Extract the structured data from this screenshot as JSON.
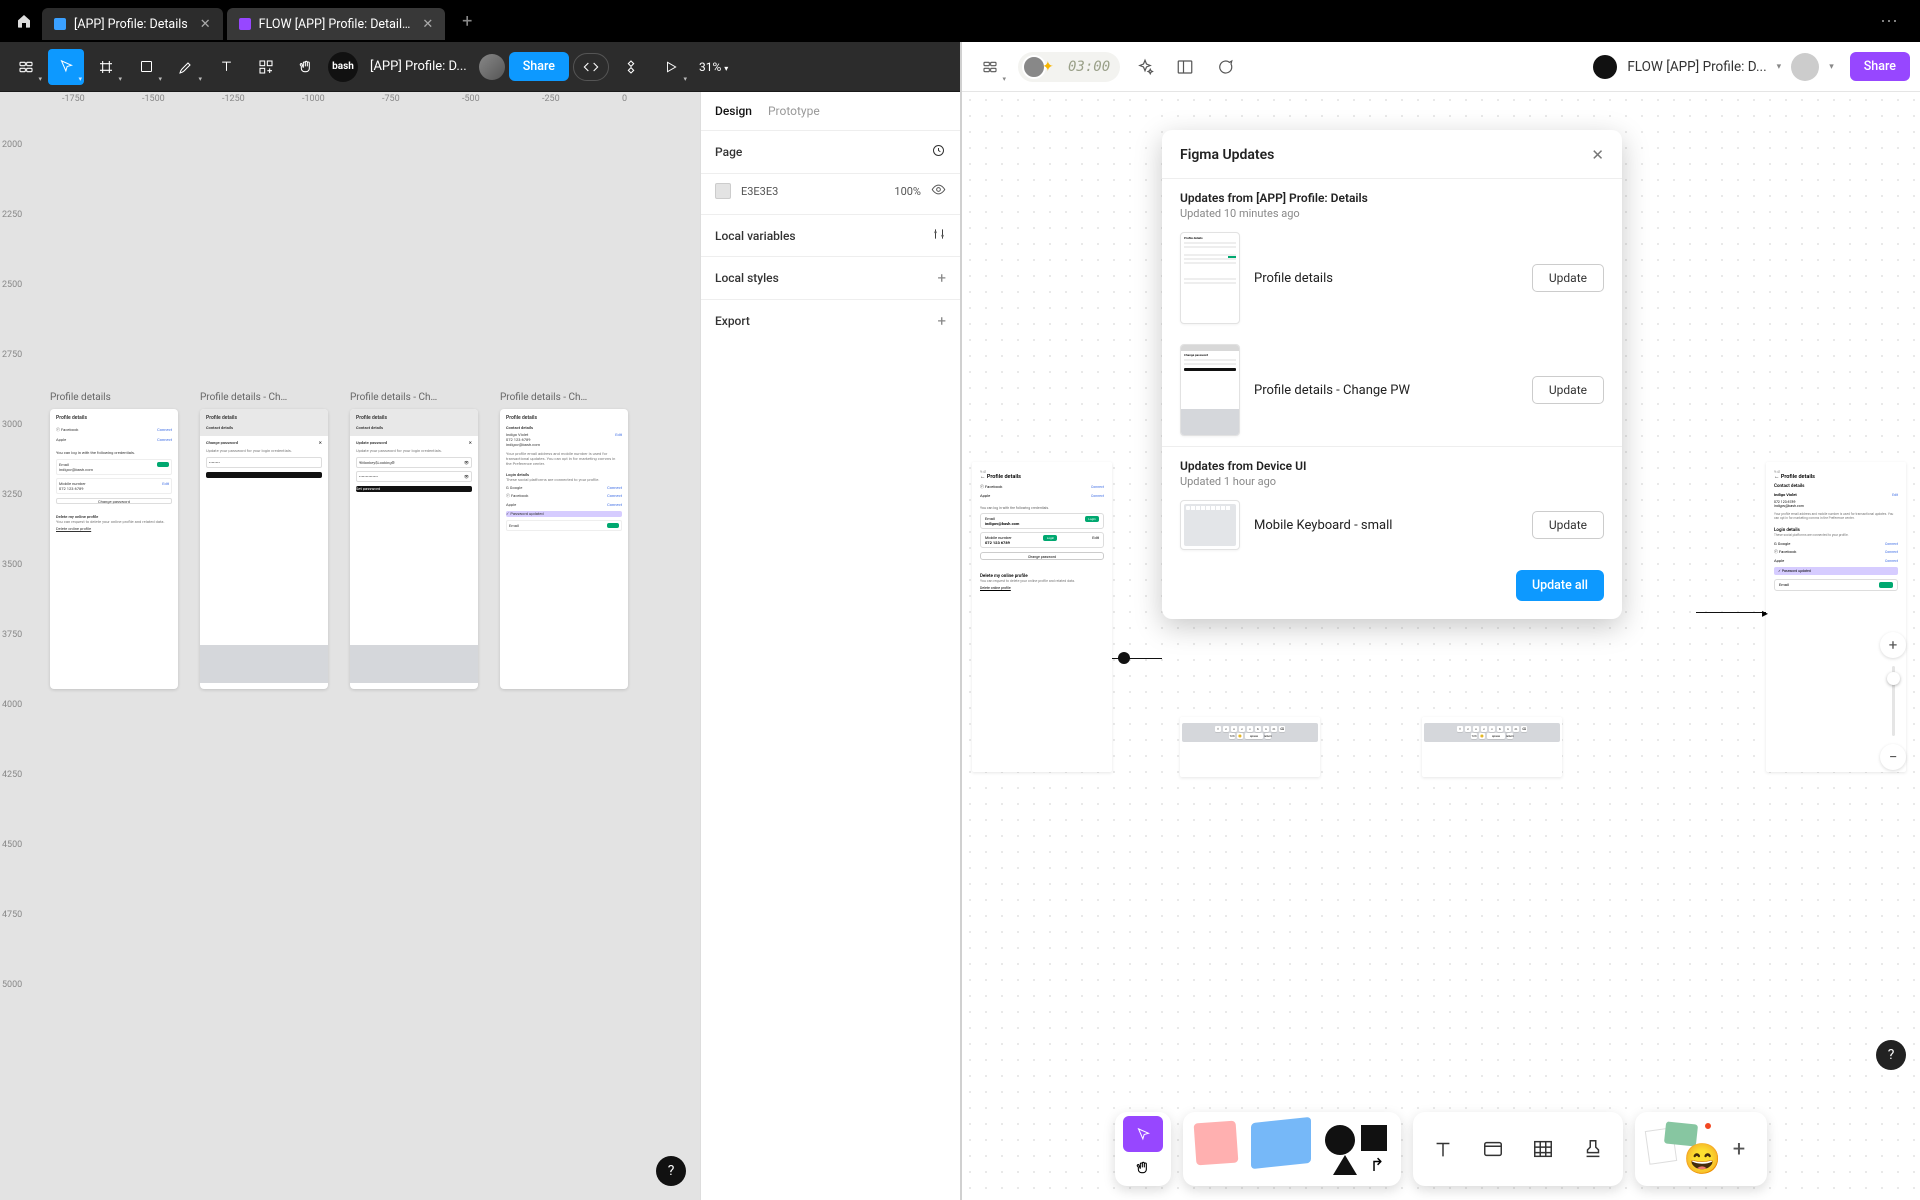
{
  "tabs": [
    {
      "label": "[APP] Profile: Details",
      "color": "#3aa0ff"
    },
    {
      "label": "FLOW [APP] Profile: Detail…",
      "color": "#9747ff"
    }
  ],
  "left": {
    "doc_title": "[APP] Profile: D...",
    "share": "Share",
    "zoom": "31%",
    "ruler_h": [
      "-1750",
      "-1500",
      "-1250",
      "-1000",
      "-750",
      "-500",
      "-250",
      "0"
    ],
    "ruler_v": [
      "2000",
      "2250",
      "2500",
      "2750",
      "3000",
      "3250",
      "3500",
      "3750",
      "4000",
      "4250",
      "4500",
      "4750",
      "5000"
    ],
    "frames": [
      "Profile details",
      "Profile details - Ch…",
      "Profile details - Ch…",
      "Profile details - Ch…"
    ],
    "panel": {
      "tabs": {
        "design": "Design",
        "prototype": "Prototype"
      },
      "page_label": "Page",
      "color_hex": "E3E3E3",
      "color_opacity": "100%",
      "local_variables": "Local variables",
      "local_styles": "Local styles",
      "export": "Export"
    }
  },
  "right": {
    "doc_title": "FLOW [APP] Profile: D...",
    "timer": "03:00",
    "share": "Share",
    "popup": {
      "title": "Figma Updates",
      "group1_title": "Updates from [APP] Profile: Details",
      "group1_sub": "Updated 10 minutes ago",
      "item1": "Profile details",
      "item2": "Profile details - Change PW",
      "group2_title": "Updates from Device  UI",
      "group2_sub": "Updated 1 hour ago",
      "item3": "Mobile Keyboard - small",
      "update_btn": "Update",
      "update_all": "Update all"
    },
    "artboards": {
      "hdr": "Profile details",
      "contact": "Contact details",
      "name": "Indigo Violet",
      "phone": "072 123 6789",
      "email": "indigov@bash.com",
      "edit": "Edit",
      "connect": "Connect",
      "fb": "Facebook",
      "apple": "Apple",
      "google": "Google",
      "login_line": "You can log in with the following credentials.",
      "change_pw": "Change password",
      "change_pw_hdr": "Change password",
      "update_pw_hdr": "Update password",
      "delete_hdr": "Delete my online profile",
      "delete_body": "You can request to delete your online profile and related data.",
      "delete_link": "Delete online profile",
      "login_details": "Login details",
      "login_body": "These social platforms are connected to your profile.",
      "pw_updated": "Password updated",
      "mobile_label": "Mobile number",
      "email_label": "Email",
      "info_body": "Your profile email address and mobile number is used for transactional updates. You can opt in for marketing comms in the Preference center."
    }
  }
}
